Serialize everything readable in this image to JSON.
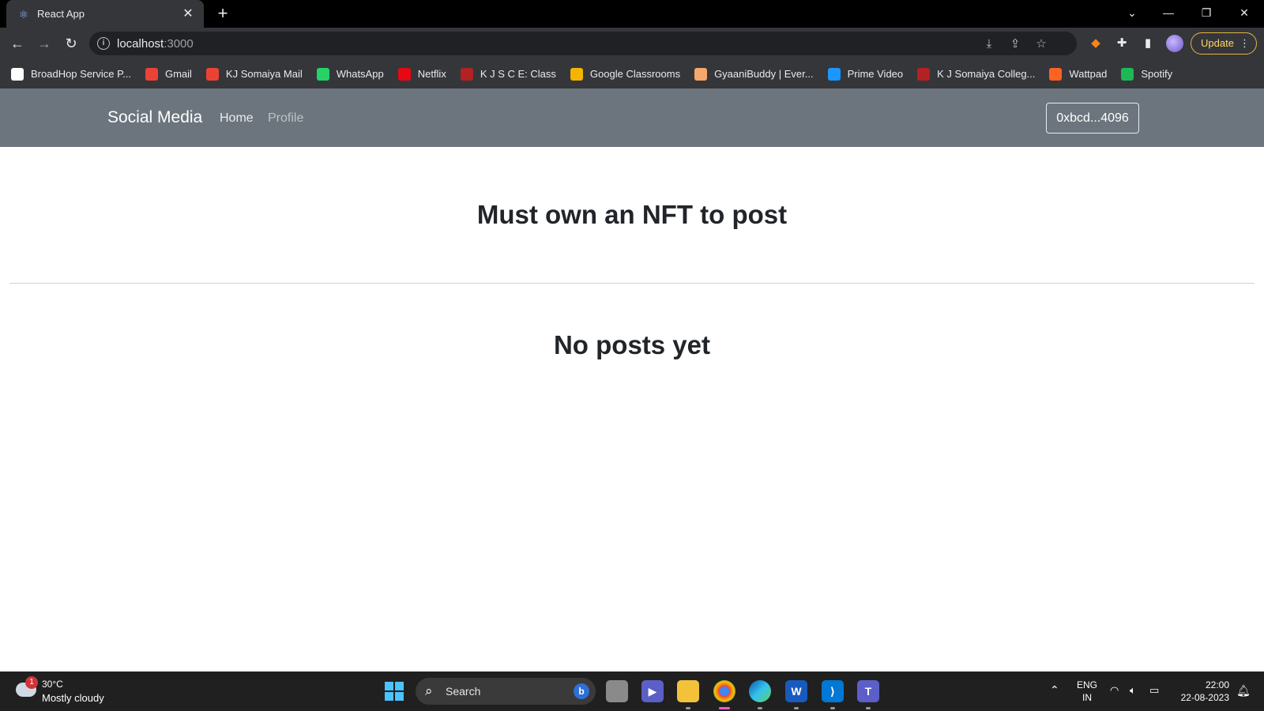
{
  "browser": {
    "tab_title": "React App",
    "new_tab_symbol": "+",
    "url_host": "localhost",
    "url_port": ":3000",
    "update_label": "Update"
  },
  "bookmarks": [
    {
      "label": "BroadHop Service P...",
      "icon": "broadhop-icon",
      "color": "#ffffff"
    },
    {
      "label": "Gmail",
      "icon": "gmail-icon",
      "color": "#ea4335"
    },
    {
      "label": "KJ Somaiya Mail",
      "icon": "gmail-icon",
      "color": "#ea4335"
    },
    {
      "label": "WhatsApp",
      "icon": "whatsapp-icon",
      "color": "#25d366"
    },
    {
      "label": "Netflix",
      "icon": "netflix-icon",
      "color": "#e50914"
    },
    {
      "label": "K J S C E: Class",
      "icon": "class-icon",
      "color": "#b22222"
    },
    {
      "label": "Google Classrooms",
      "icon": "classroom-icon",
      "color": "#f4b400"
    },
    {
      "label": "GyaaniBuddy | Ever...",
      "icon": "gyaanibuddy-icon",
      "color": "#f7a76c"
    },
    {
      "label": "Prime Video",
      "icon": "prime-video-icon",
      "color": "#1a98ff"
    },
    {
      "label": "K J Somaiya Colleg...",
      "icon": "somaiya-icon",
      "color": "#b22222"
    },
    {
      "label": "Wattpad",
      "icon": "wattpad-icon",
      "color": "#ff6122"
    },
    {
      "label": "Spotify",
      "icon": "spotify-icon",
      "color": "#1db954"
    }
  ],
  "app": {
    "brand": "Social Media",
    "nav_home": "Home",
    "nav_profile": "Profile",
    "wallet_address": "0xbcd...4096",
    "notice": "Must own an NFT to post",
    "empty_state": "No posts yet",
    "navbar_color": "#6c757d"
  },
  "taskbar": {
    "weather_badge": "1",
    "temperature": "30°C",
    "weather": "Mostly cloudy",
    "search_label": "Search",
    "lang_line1": "ENG",
    "lang_line2": "IN",
    "time": "22:00",
    "date": "22-08-2023"
  }
}
